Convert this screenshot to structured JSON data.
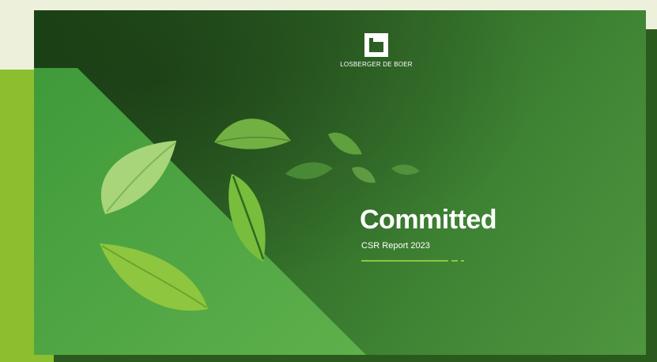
{
  "brand": {
    "name": "LOSBERGER DE BOER"
  },
  "cover": {
    "title": "Committed",
    "subtitle": "CSR Report 2023"
  },
  "colors": {
    "page_background": "#edf1dc",
    "accent_lime": "#8cbf2f",
    "slide_dark_green": "#2d6224",
    "slide_light_green": "#4f963f",
    "rule_green": "#8cc63f",
    "text": "#ffffff"
  },
  "icons": [
    "brand-logo-mark-icon",
    "leaf-icon"
  ]
}
